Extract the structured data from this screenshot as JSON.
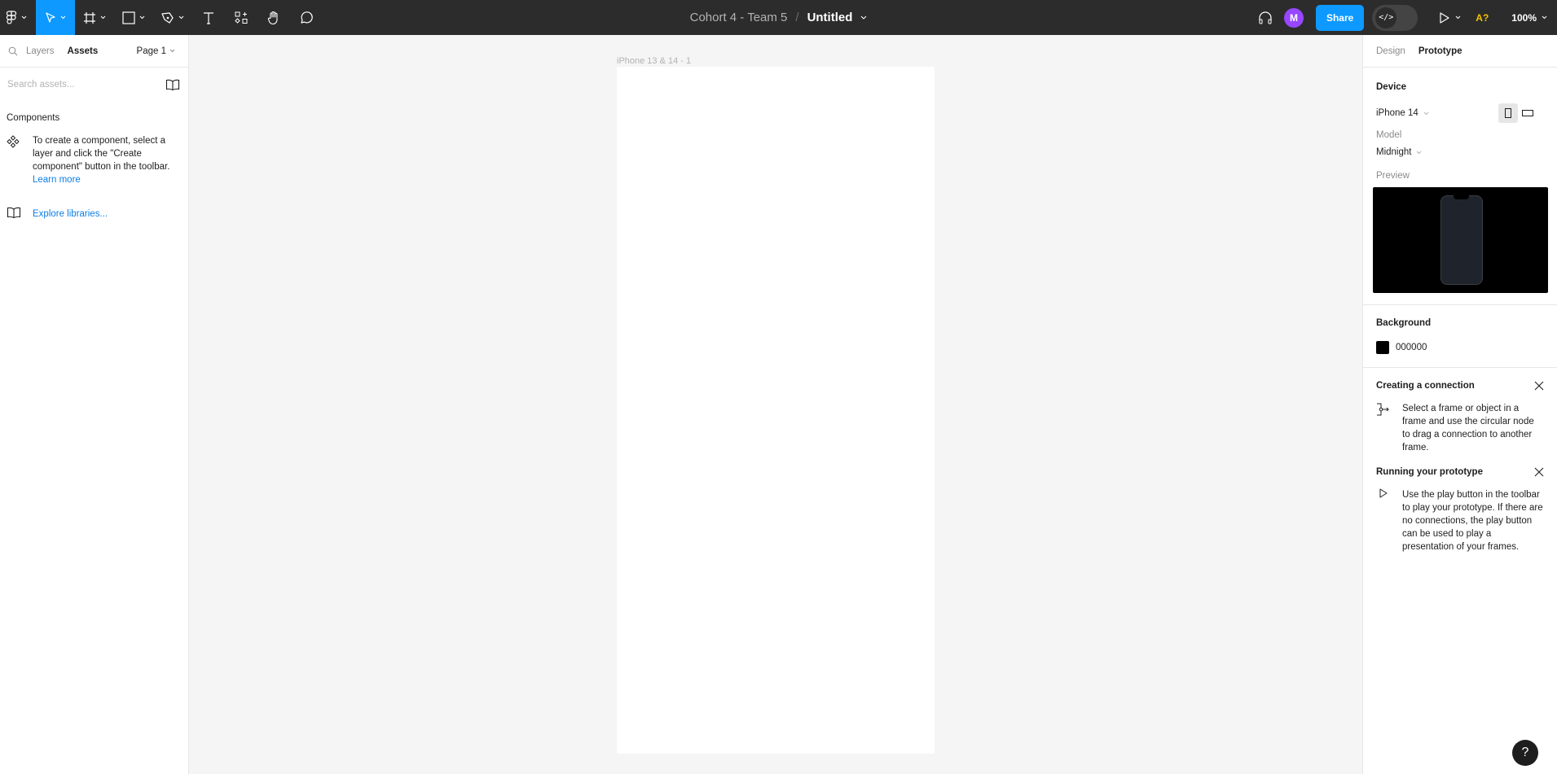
{
  "toolbar": {
    "tools": [
      {
        "name": "main-menu",
        "icon": "figma-logo-icon",
        "has_dropdown": true
      },
      {
        "name": "move",
        "icon": "move-cursor-icon",
        "has_dropdown": true,
        "active": true
      },
      {
        "name": "frame",
        "icon": "frame-icon",
        "has_dropdown": true
      },
      {
        "name": "shape",
        "icon": "rectangle-icon",
        "has_dropdown": true
      },
      {
        "name": "pen",
        "icon": "pen-icon",
        "has_dropdown": true
      },
      {
        "name": "text",
        "icon": "text-icon"
      },
      {
        "name": "resources",
        "icon": "resources-icon"
      },
      {
        "name": "hand",
        "icon": "hand-icon"
      },
      {
        "name": "comment",
        "icon": "comment-icon"
      }
    ],
    "team": "Cohort 4 - Team 5",
    "separator": "/",
    "file_name": "Untitled",
    "avatar_initial": "M",
    "share_label": "Share",
    "dev_mode_label": "</>",
    "a11y_label": "A?",
    "zoom_level": "100%",
    "accent": "#0d99ff",
    "avatar_color": "#9747ff"
  },
  "left_panel": {
    "tabs": [
      {
        "label": "Layers",
        "active": false
      },
      {
        "label": "Assets",
        "active": true
      }
    ],
    "page_selector": "Page 1",
    "search_placeholder": "Search assets...",
    "components_heading": "Components",
    "components_hint": "To create a component, select a layer and click the \"Create component\" button in the toolbar.",
    "learn_more": "Learn more",
    "explore_libraries": "Explore libraries..."
  },
  "canvas": {
    "frame_name": "iPhone 13 & 14 - 1"
  },
  "right_panel": {
    "tabs": [
      {
        "label": "Design",
        "active": false
      },
      {
        "label": "Prototype",
        "active": true
      }
    ],
    "device_heading": "Device",
    "device_value": "iPhone 14",
    "orientation": "portrait",
    "model_label": "Model",
    "model_value": "Midnight",
    "preview_label": "Preview",
    "background_heading": "Background",
    "background_color": "000000",
    "tips": [
      {
        "title": "Creating a connection",
        "icon": "connection-icon",
        "body": "Select a frame or object in a frame and use the circular node to drag a connection to another frame."
      },
      {
        "title": "Running your prototype",
        "icon": "play-icon",
        "body": "Use the play button in the toolbar to play your prototype. If there are no connections, the play button can be used to play a presentation of your frames."
      }
    ]
  },
  "help_label": "?"
}
